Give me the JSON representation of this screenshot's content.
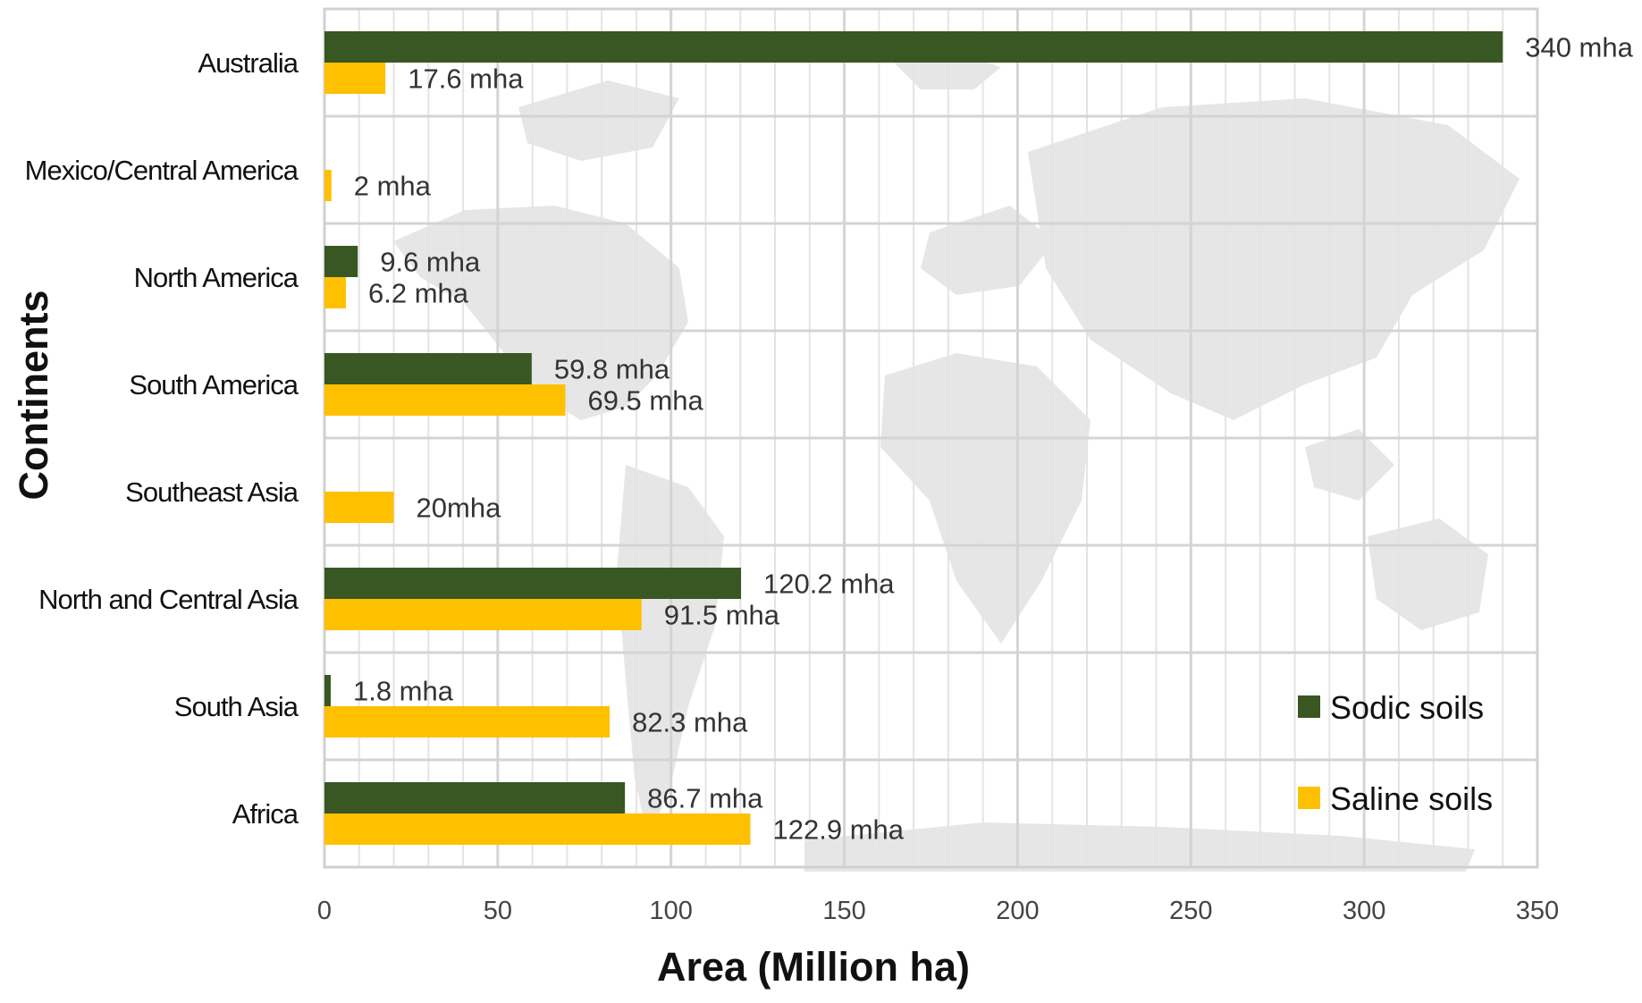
{
  "chart_data": {
    "type": "bar",
    "orientation": "horizontal",
    "categories": [
      "Australia",
      "Mexico/Central America",
      "North America",
      "South America",
      "Southeast Asia",
      "North and Central Asia",
      "South Asia",
      "Africa"
    ],
    "series": [
      {
        "name": "Sodic soils",
        "color": "#385723",
        "values": [
          340,
          null,
          9.6,
          59.8,
          null,
          120.2,
          1.8,
          86.7
        ],
        "labels": [
          "340 mha",
          null,
          "9.6 mha",
          "59.8 mha",
          null,
          "120.2 mha",
          "1.8 mha",
          "86.7 mha"
        ]
      },
      {
        "name": "Saline soils",
        "color": "#FFC000",
        "values": [
          17.6,
          2,
          6.2,
          69.5,
          20,
          91.5,
          82.3,
          122.9
        ],
        "labels": [
          "17.6 mha",
          "2 mha",
          "6.2 mha",
          "69.5 mha",
          "20mha",
          "91.5 mha",
          "82.3 mha",
          "122.9 mha"
        ]
      }
    ],
    "xlabel": "Area (Million ha)",
    "ylabel": "Continents",
    "xlim": [
      0,
      350
    ],
    "xticks": [
      0,
      50,
      100,
      150,
      200,
      250,
      300,
      350
    ],
    "grid": true,
    "legend_position": "bottom-right",
    "background": "world map silhouette"
  }
}
